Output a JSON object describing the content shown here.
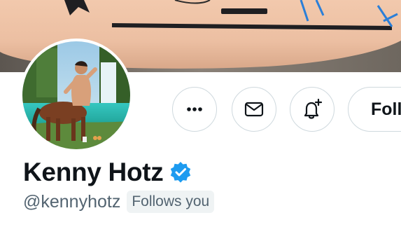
{
  "profile": {
    "display_name": "Kenny Hotz",
    "handle": "@kennyhotz",
    "follows_you": "Follows you",
    "verified": true
  },
  "actions": {
    "more": "more-icon",
    "message": "envelope-icon",
    "notify": "bell-plus-icon",
    "follow_label": "Follow"
  },
  "colors": {
    "text_primary": "#0f1419",
    "text_secondary": "#536471",
    "verified_blue": "#1d9bf0",
    "button_border": "#cfd9de",
    "badge_bg": "#eff3f4"
  }
}
